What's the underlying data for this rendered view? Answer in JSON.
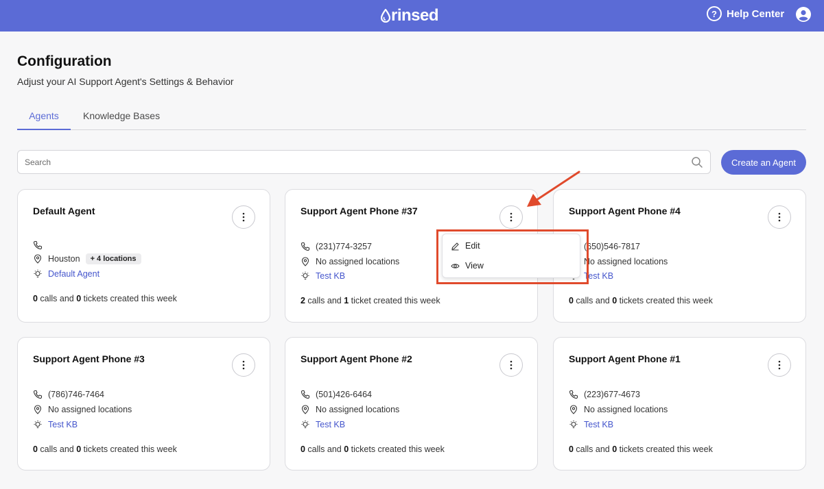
{
  "header": {
    "logo_text": "rinsed",
    "help_label": "Help Center",
    "help_icon_glyph": "?",
    "accent_color": "#5b6bd6"
  },
  "page": {
    "title": "Configuration",
    "subtitle": "Adjust your AI Support Agent's Settings & Behavior"
  },
  "tabs": [
    {
      "label": "Agents",
      "active": true
    },
    {
      "label": "Knowledge Bases",
      "active": false
    }
  ],
  "search": {
    "placeholder": "Search",
    "value": ""
  },
  "create_button": {
    "label": "Create an Agent"
  },
  "agents": [
    {
      "name": "Default Agent",
      "phone": "",
      "location": "Houston",
      "location_badge": "+ 4 locations",
      "knowledge_base": "Default Agent",
      "calls": "0",
      "calls_text": " calls and ",
      "tickets": "0",
      "tickets_text": " tickets created this week"
    },
    {
      "name": "Support Agent Phone #37",
      "phone": "(231)774-3257",
      "location": "No assigned locations",
      "knowledge_base": "Test KB",
      "calls": "2",
      "calls_text": " calls and ",
      "tickets": "1",
      "tickets_text": " ticket created this week"
    },
    {
      "name": "Support Agent Phone #4",
      "phone": "(650)546-7817",
      "location": "No assigned locations",
      "knowledge_base": "Test KB",
      "calls": "0",
      "calls_text": " calls and ",
      "tickets": "0",
      "tickets_text": " tickets created this week"
    },
    {
      "name": "Support Agent Phone #3",
      "phone": "(786)746-7464",
      "location": "No assigned locations",
      "knowledge_base": "Test KB",
      "calls": "0",
      "calls_text": " calls and ",
      "tickets": "0",
      "tickets_text": " tickets created this week"
    },
    {
      "name": "Support Agent Phone #2",
      "phone": "(501)426-6464",
      "location": "No assigned locations",
      "knowledge_base": "Test KB",
      "calls": "0",
      "calls_text": " calls and ",
      "tickets": "0",
      "tickets_text": " tickets created this week"
    },
    {
      "name": "Support Agent Phone #1",
      "phone": "(223)677-4673",
      "location": "No assigned locations",
      "knowledge_base": "Test KB",
      "calls": "0",
      "calls_text": " calls and ",
      "tickets": "0",
      "tickets_text": " tickets created this week"
    }
  ],
  "context_menu": {
    "items": [
      {
        "label": "Edit",
        "icon": "pencil-icon"
      },
      {
        "label": "View",
        "icon": "eye-icon"
      }
    ]
  },
  "annotation": {
    "color": "#e04a2c"
  }
}
